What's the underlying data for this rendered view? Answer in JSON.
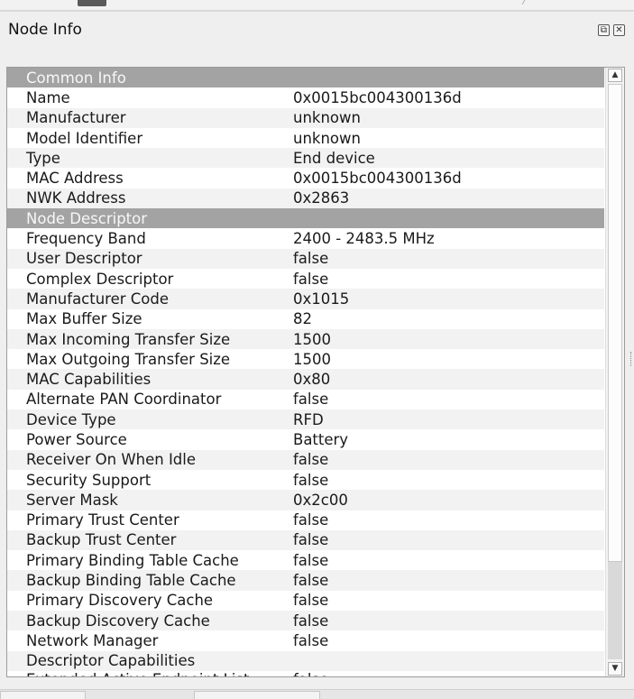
{
  "panel": {
    "title": "Node Info",
    "float_glyph": "⧉",
    "close_glyph": "✕"
  },
  "scrollbar": {
    "up_glyph": "▲",
    "down_glyph": "▼"
  },
  "rows": [
    {
      "type": "section",
      "label": "Common Info"
    },
    {
      "label": "Name",
      "value": "0x0015bc004300136d"
    },
    {
      "label": "Manufacturer",
      "value": "unknown"
    },
    {
      "label": "Model Identifier",
      "value": "unknown"
    },
    {
      "label": "Type",
      "value": "End device"
    },
    {
      "label": "MAC Address",
      "value": "0x0015bc004300136d"
    },
    {
      "label": "NWK Address",
      "value": "0x2863"
    },
    {
      "type": "section",
      "label": "Node Descriptor"
    },
    {
      "label": "Frequency Band",
      "value": "2400 - 2483.5 MHz"
    },
    {
      "label": "User Descriptor",
      "value": "false"
    },
    {
      "label": "Complex Descriptor",
      "value": "false"
    },
    {
      "label": "Manufacturer Code",
      "value": "0x1015"
    },
    {
      "label": "Max Buffer Size",
      "value": "82"
    },
    {
      "label": "Max Incoming Transfer Size",
      "value": "1500"
    },
    {
      "label": "Max Outgoing Transfer Size",
      "value": "1500"
    },
    {
      "label": "MAC Capabilities",
      "value": "0x80"
    },
    {
      "label": "Alternate PAN Coordinator",
      "value": "false"
    },
    {
      "label": "Device Type",
      "value": "RFD"
    },
    {
      "label": "Power Source",
      "value": "Battery"
    },
    {
      "label": "Receiver On When Idle",
      "value": "false"
    },
    {
      "label": "Security Support",
      "value": "false"
    },
    {
      "label": "Server Mask",
      "value": "0x2c00"
    },
    {
      "label": "Primary Trust Center",
      "value": "false"
    },
    {
      "label": "Backup Trust Center",
      "value": "false"
    },
    {
      "label": "Primary Binding Table Cache",
      "value": "false"
    },
    {
      "label": "Backup Binding Table Cache",
      "value": "false"
    },
    {
      "label": "Primary Discovery Cache",
      "value": "false"
    },
    {
      "label": "Backup Discovery Cache",
      "value": "false"
    },
    {
      "label": "Network Manager",
      "value": "false"
    },
    {
      "label": "Descriptor Capabilities",
      "value": ""
    },
    {
      "label": "Extended Active Endpoint List",
      "value": "false",
      "clipped": true
    }
  ]
}
